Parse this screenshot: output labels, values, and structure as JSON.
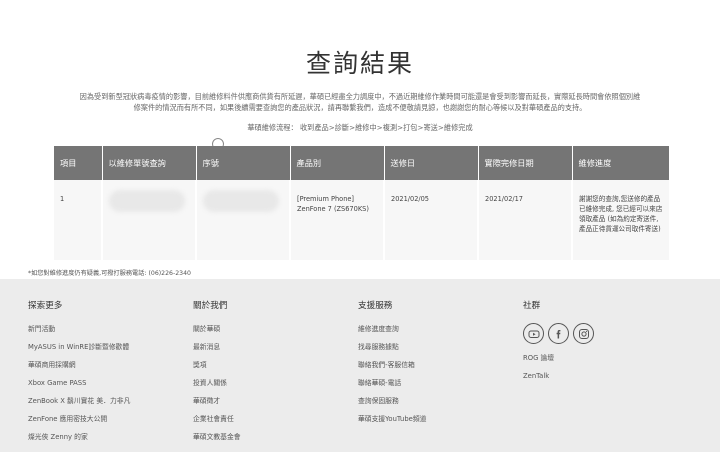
{
  "page": {
    "title": "查詢結果",
    "notice_line1": "因為受到新型冠狀病毒疫情的影響，目前維修料件供應商供貨有所延遲，華碩已經盡全力調度中，不過近期維修作業時間可能還是會受到影響而延長，實際延長時間會依照個別維",
    "notice_line2": "修案件的情況而有所不同，如果後續需要查詢您的產品狀況，請再聯繫我們，造成不便敬請見諒，也謝謝您的耐心等候以及對華碩產品的支持。",
    "flow": "華碩維修流程： 收到產品>診斷>維修中>複測>打包>寄送>維修完成"
  },
  "table": {
    "headers": [
      "項目",
      "以維修單號查詢",
      "序號",
      "產品別",
      "送修日",
      "實際完修日期",
      "維修進度"
    ],
    "rows": [
      {
        "item": "1",
        "product_line1": "[Premium Phone]",
        "product_line2": "ZenFone 7 (ZS670KS)",
        "sent_date": "2021/02/05",
        "done_date": "2021/02/17",
        "progress": "謝謝您的查詢,您送修的產品已維修完成, 您已經可以來店領取產品 (如為約定寄送件, 產品正待貨運公司取件寄送)"
      }
    ]
  },
  "footnote": "*如您對維修進度仍有疑義,可撥打服務電話: (06)226-2340",
  "footer": {
    "explore": {
      "title": "探索更多",
      "links": [
        "新門活動",
        "MyASUS in WinRE診斷暨修歡體",
        "華碩商用採購網",
        "Xbox Game PASS",
        "ZenBook X 鬍川實花 美．力非凡",
        "ZenFone 應用密技大公開",
        "燦光俠 Zenny 的家"
      ]
    },
    "about": {
      "title": "關於我們",
      "links": [
        "關於華碩",
        "最新消息",
        "獎項",
        "投資人關係",
        "華碩徵才",
        "企業社會責任",
        "華碩文教基金會"
      ]
    },
    "support": {
      "title": "支援服務",
      "links": [
        "維修進度查詢",
        "找尋服務據點",
        "聯絡我們-客服信箱",
        "聯絡華碩-電話",
        "查詢保固服務",
        "華碩支援YouTube頻道"
      ]
    },
    "social": {
      "title": "社群",
      "icons": [
        "youtube-icon",
        "facebook-icon",
        "instagram-icon"
      ],
      "links": [
        "ROG 論壇",
        "ZenTalk"
      ]
    }
  }
}
